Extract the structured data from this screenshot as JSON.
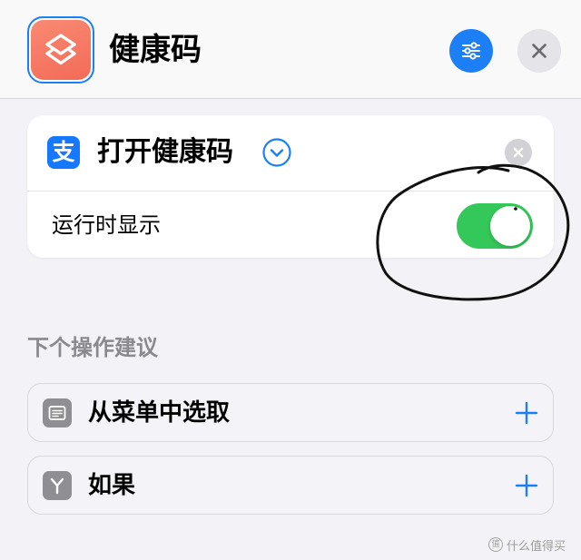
{
  "header": {
    "title": "健康码",
    "app_icon": "shortcuts-icon",
    "filter_icon": "sliders-icon",
    "close_icon": "close-icon"
  },
  "action_card": {
    "action": {
      "icon": "alipay-icon",
      "icon_glyph": "支",
      "label": "打开健康码",
      "expand_icon": "chevron-down-circle-icon",
      "remove_icon": "clear-icon"
    },
    "show_when_run": {
      "label": "运行时显示",
      "toggle_on": true
    }
  },
  "suggestions": {
    "heading": "下个操作建议",
    "items": [
      {
        "label": "从菜单中选取",
        "icon": "menu-icon",
        "add_icon": "plus-icon"
      },
      {
        "label": "如果",
        "icon": "if-branch-icon",
        "add_icon": "plus-icon"
      }
    ]
  },
  "watermark": {
    "logo_glyph": "值",
    "text": "什么值得买"
  },
  "colors": {
    "accent": "#1c7ff6",
    "toggle": "#34c759",
    "alipay": "#1677ff",
    "app_icon": "#f26b57",
    "header_bg": "#f9f9f9",
    "background": "#f2f2f7",
    "secondary_text": "#8a8a8e",
    "icon_gray": "#8e8e93",
    "annotation": "#111111"
  }
}
